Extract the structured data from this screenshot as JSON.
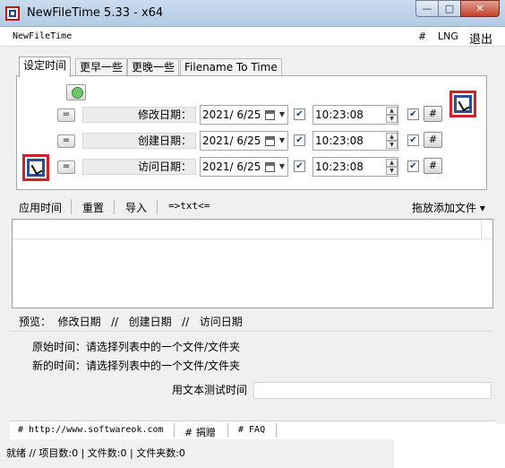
{
  "window": {
    "title": "NewFileTime 5.33 - x64",
    "minimize": "—",
    "maximize": "□",
    "close": "✕"
  },
  "menu": {
    "app_name": "NewFileTime",
    "hash": "#",
    "lng": "LNG",
    "exit": "退出"
  },
  "tabs": [
    {
      "label": "设定时间",
      "active": true
    },
    {
      "label": "更早一些",
      "active": false
    },
    {
      "label": "更晚一些",
      "active": false
    },
    {
      "label": "Filename To Time",
      "active": false
    }
  ],
  "rows": [
    {
      "eq": "=",
      "label": "修改日期：",
      "date": "2021/ 6/25",
      "date_checked": true,
      "time": "10:23:08",
      "time_checked": true,
      "hash": "#"
    },
    {
      "eq": "=",
      "label": "创建日期：",
      "date": "2021/ 6/25",
      "date_checked": true,
      "time": "10:23:08",
      "time_checked": true,
      "hash": "#"
    },
    {
      "eq": "=",
      "label": "访问日期：",
      "date": "2021/ 6/25",
      "date_checked": true,
      "time": "10:23:08",
      "time_checked": true,
      "hash": "#"
    }
  ],
  "icons": {
    "clock": "clock-icon",
    "app": "newfiletime-logo-icon",
    "calendar": "calendar-icon"
  },
  "toolbar": {
    "apply": "应用时间",
    "reset": "重置",
    "import": "导入",
    "txt": "=>txt<=",
    "drag_add": "拖放添加文件 ▾"
  },
  "preview": {
    "label": "预览：",
    "modify": "修改日期",
    "sep1": "//",
    "create": "创建日期",
    "sep2": "//",
    "access": "访问日期"
  },
  "info": {
    "original": "原始时间：请选择列表中的一个文件/文件夹",
    "new": "新的时间：请选择列表中的一个文件/文件夹"
  },
  "test": {
    "label": "用文本测试时间",
    "value": ""
  },
  "footer": {
    "website": "# http://www.softwareok.com",
    "donate": "# 捐赠",
    "faq": "# FAQ"
  },
  "status": {
    "text": "就绪 // 项目数:0 | 文件数:0 | 文件夹数:0"
  },
  "colors": {
    "accent_red": "#d0202a",
    "accent_blue": "#2c4d9c"
  }
}
